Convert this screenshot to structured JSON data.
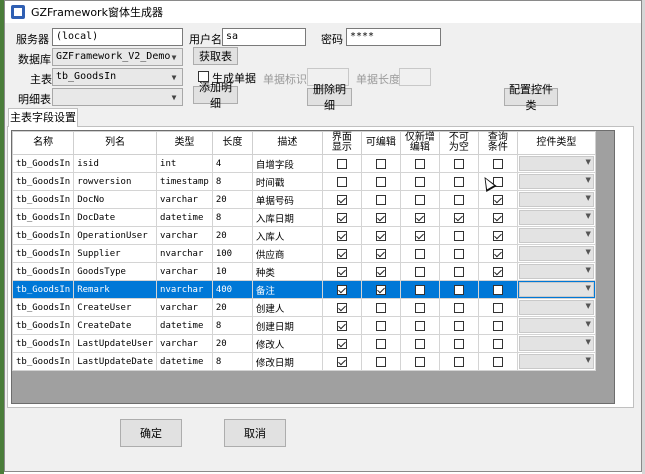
{
  "window": {
    "title": "GZFramework窗体生成器"
  },
  "form": {
    "server_label": "服务器",
    "server_value": "(local)",
    "user_label": "用户名",
    "user_value": "sa",
    "password_label": "密码",
    "password_value": "****",
    "database_label": "数据库",
    "database_value": "GZFramework_V2_Demo",
    "get_table_button": "获取表",
    "main_table_label": "主表",
    "main_table_value": "tb_GoodsIn",
    "generate_code_label": "生成单据",
    "code_flag_label": "单据标识",
    "code_length_label": "单据长度",
    "detail_table_label": "明细表",
    "detail_table_value": "",
    "add_detail_button": "添加明细",
    "delete_detail_button": "删除明细",
    "config_control_button": "配置控件类"
  },
  "tab": {
    "label": "主表字段设置"
  },
  "grid": {
    "headers": [
      "名称",
      "列名",
      "类型",
      "长度",
      "描述",
      "界面\n显示",
      "可编辑",
      "仅新增\n编辑",
      "不可\n为空",
      "查询\n条件",
      "控件类型"
    ],
    "rows": [
      {
        "name": "tb_GoodsIn",
        "col": "isid",
        "type": "int",
        "len": "4",
        "desc": "自增字段",
        "c": [
          false,
          false,
          false,
          false,
          false
        ]
      },
      {
        "name": "tb_GoodsIn",
        "col": "rowversion",
        "type": "timestamp",
        "len": "8",
        "desc": "时间戳",
        "c": [
          false,
          false,
          false,
          false,
          false
        ]
      },
      {
        "name": "tb_GoodsIn",
        "col": "DocNo",
        "type": "varchar",
        "len": "20",
        "desc": "单据号码",
        "c": [
          true,
          false,
          false,
          false,
          true
        ]
      },
      {
        "name": "tb_GoodsIn",
        "col": "DocDate",
        "type": "datetime",
        "len": "8",
        "desc": "入库日期",
        "c": [
          true,
          true,
          true,
          true,
          true
        ]
      },
      {
        "name": "tb_GoodsIn",
        "col": "OperationUser",
        "type": "varchar",
        "len": "20",
        "desc": "入库人",
        "c": [
          true,
          true,
          true,
          false,
          true
        ]
      },
      {
        "name": "tb_GoodsIn",
        "col": "Supplier",
        "type": "nvarchar",
        "len": "100",
        "desc": "供应商",
        "c": [
          true,
          true,
          false,
          false,
          true
        ]
      },
      {
        "name": "tb_GoodsIn",
        "col": "GoodsType",
        "type": "varchar",
        "len": "10",
        "desc": "种类",
        "c": [
          true,
          true,
          false,
          false,
          true
        ]
      },
      {
        "name": "tb_GoodsIn",
        "col": "Remark",
        "type": "nvarchar",
        "len": "400",
        "desc": "备注",
        "c": [
          true,
          true,
          false,
          false,
          false
        ],
        "selected": true
      },
      {
        "name": "tb_GoodsIn",
        "col": "CreateUser",
        "type": "varchar",
        "len": "20",
        "desc": "创建人",
        "c": [
          true,
          false,
          false,
          false,
          false
        ]
      },
      {
        "name": "tb_GoodsIn",
        "col": "CreateDate",
        "type": "datetime",
        "len": "8",
        "desc": "创建日期",
        "c": [
          true,
          false,
          false,
          false,
          false
        ]
      },
      {
        "name": "tb_GoodsIn",
        "col": "LastUpdateUser",
        "type": "varchar",
        "len": "20",
        "desc": "修改人",
        "c": [
          true,
          false,
          false,
          false,
          false
        ]
      },
      {
        "name": "tb_GoodsIn",
        "col": "LastUpdateDate",
        "type": "datetime",
        "len": "8",
        "desc": "修改日期",
        "c": [
          true,
          false,
          false,
          false,
          false
        ]
      }
    ]
  },
  "footer": {
    "ok_button": "确定",
    "cancel_button": "取消"
  },
  "colors": {
    "selection": "#0078d7",
    "window_bg": "#f0f0f0",
    "grid_bg": "#a0a0a0"
  }
}
